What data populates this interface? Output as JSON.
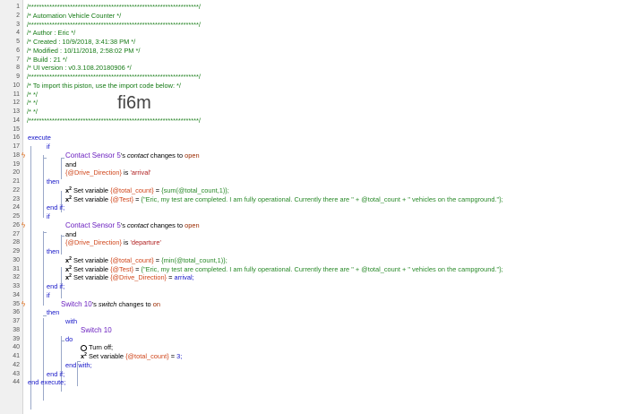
{
  "header": {
    "line1": "/******************************************************************/",
    "line2": "/* Automation Vehicle Counter                                            */",
    "line3": "/******************************************************************/",
    "line4": "/* Author     : Eric                                         */",
    "line5": "/* Created    : 10/9/2018, 3:41:38 PM                        */",
    "line6": "/* Modified   : 10/11/2018, 2:58:02 PM                        */",
    "line7": "/* Build      : 21                                  */",
    "line8": "/* UI version : v0.3.108.20180906                           */",
    "line9": "/******************************************************************/",
    "line10": "/* To import this piston, use the import code below:          */",
    "line11": "/*                                  */",
    "line12": "/*                                  */",
    "line13": "/*                                  */",
    "line14": "/******************************************************************/"
  },
  "watermark": "fi6m",
  "code": {
    "execute": "execute",
    "end_execute": "end execute;",
    "if": "if",
    "end_if": "end if;",
    "then": "then",
    "and": "and",
    "is": "is",
    "with": "with",
    "do": "do",
    "end_with": "end with;",
    "set_variable": "Set variable",
    "device1": "Contact Sensor 5",
    "device1_possessive": "'s",
    "attr_contact": "contact",
    "changes_to": "changes to",
    "val_open": "open",
    "var_direction": "{@Drive_Direction}",
    "str_arrival": "'arrival'",
    "str_departure": "'departure'",
    "var_total": "{@total_count}",
    "var_test": "{@Test}",
    "eq": "=",
    "sum_expr": "{sum(@total_count,1)};",
    "min_expr": "{min(@total_count,1)};",
    "test_expr": "{\"Eric, my test are completed. I am fully operational. Currently there are \" + @total_count + \" vehicles on the campground.\"};",
    "arrival_assign": "arrival;",
    "device2": "Switch 10",
    "device2_possessive": "'s",
    "attr_switch": "switch",
    "val_on": "on",
    "device_with": "Switch 10",
    "turn_off": "Turn off;",
    "three": "3;"
  },
  "line_numbers": [
    "1",
    "2",
    "3",
    "4",
    "5",
    "6",
    "7",
    "8",
    "9",
    "10",
    "11",
    "12",
    "13",
    "14",
    "15",
    "16",
    "17",
    "18",
    "19",
    "20",
    "21",
    "22",
    "23",
    "24",
    "25",
    "26",
    "27",
    "28",
    "29",
    "30",
    "31",
    "32",
    "33",
    "34",
    "35",
    "36",
    "37",
    "38",
    "39",
    "40",
    "41",
    "42",
    "43",
    "44"
  ],
  "colors": {
    "comment": "#147a14",
    "keyword": "#1515c8",
    "device": "#6a1fbf",
    "variable": "#d0461b",
    "trigger_icon": "#e07020"
  },
  "icons": {
    "trigger": "lightning-bolt-icon",
    "set_variable": "x-squared-icon",
    "turn_off": "power-icon"
  }
}
